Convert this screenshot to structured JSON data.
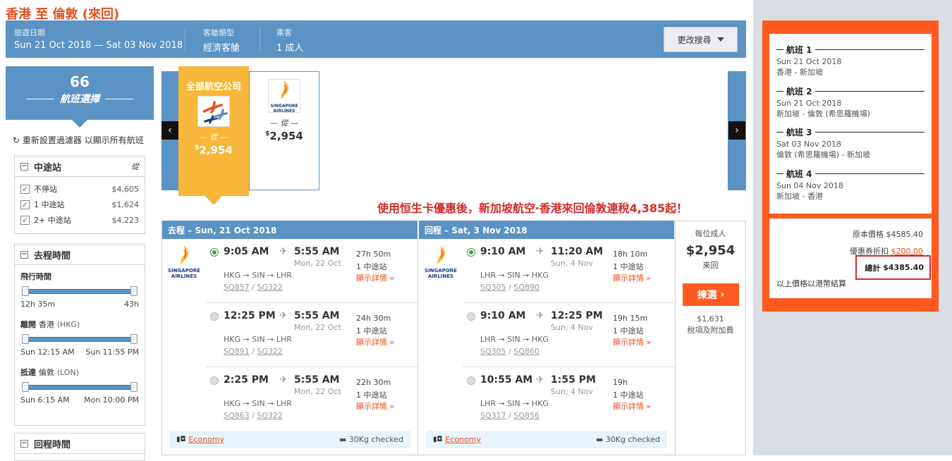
{
  "page_title": "香港 至 倫敦 (來回)",
  "search": {
    "date_label": "旅遊日期",
    "date_value": "Sun 21 Oct 2018 — Sat 03 Nov 2018",
    "cabin_label": "客艙類型",
    "cabin_value": "經濟客艙",
    "pax_label": "乘客",
    "pax_value": "1 成人",
    "change_button": "更改搜尋"
  },
  "sidebar": {
    "count": "66",
    "count_label": "航班選擇",
    "reset": "重新設置過濾器 以顯示所有航班",
    "stops": {
      "title": "中途站",
      "from": "從",
      "items": [
        {
          "label": "不停站",
          "price": "$4,605"
        },
        {
          "label": "1 中途站",
          "price": "$1,624"
        },
        {
          "label": "2+ 中途站",
          "price": "$4,223"
        }
      ]
    },
    "outbound": {
      "title": "去程時間",
      "duration_label": "飛行時間",
      "duration_min": "12h 35m",
      "duration_max": "43h",
      "depart_label": "離開",
      "depart_city": "香港",
      "depart_code": "(HKG)",
      "depart_min": "Sun 12:15 AM",
      "depart_max": "Sun 11:55 PM",
      "arrive_label": "抵達",
      "arrive_city": "倫敦",
      "arrive_code": "(LON)",
      "arrive_min": "Sun 6:15 AM",
      "arrive_max": "Mon 10:00 PM"
    },
    "return": {
      "title": "回程時間"
    }
  },
  "carousel": {
    "all_airlines_label": "全部航空公司",
    "all_from": "從",
    "all_price": "2,954",
    "sq_name": "SINGAPORE AIRLINES",
    "sq_from": "從",
    "sq_price": "2,954",
    "currency": "$",
    "prev": "‹",
    "next": "›"
  },
  "promo": "使用恒生卡優惠後，新加坡航空‧香港來回倫敦連稅4,385起！",
  "outbound": {
    "header": "去程 – Sun, 21 Oct 2018",
    "flights": [
      {
        "dep": "9:05 AM",
        "arr": "5:55 AM",
        "arr_date": "Mon, 22 Oct",
        "route": "HKG → SIN → LHR",
        "code1": "SQ857",
        "code2": "SQ322",
        "dur": "27h 50m",
        "stops": "1 中途站",
        "details": "顯示詳情 »",
        "selected": true
      },
      {
        "dep": "12:25 PM",
        "arr": "5:55 AM",
        "arr_date": "Mon, 22 Oct",
        "route": "HKG → SIN → LHR",
        "code1": "SQ891",
        "code2": "SQ322",
        "dur": "24h 30m",
        "stops": "1 中途站",
        "details": "顯示詳情 »",
        "selected": false
      },
      {
        "dep": "2:25 PM",
        "arr": "5:55 AM",
        "arr_date": "Mon, 22 Oct",
        "route": "HKG → SIN → LHR",
        "code1": "SQ863",
        "code2": "SQ322",
        "dur": "22h 30m",
        "stops": "1 中途站",
        "details": "顯示詳情 »",
        "selected": false
      }
    ],
    "cabin": "Economy",
    "baggage": "30Kg checked"
  },
  "inbound": {
    "header": "回程 – Sat, 3 Nov 2018",
    "flights": [
      {
        "dep": "9:10 AM",
        "arr": "11:20 AM",
        "arr_date": "Sun, 4 Nov",
        "route": "LHR → SIN → HKG",
        "code1": "SQ305",
        "code2": "SQ890",
        "dur": "18h 10m",
        "stops": "1 中途站",
        "details": "顯示詳情 »",
        "selected": true
      },
      {
        "dep": "9:10 AM",
        "arr": "12:25 PM",
        "arr_date": "Sun, 4 Nov",
        "route": "LHR → SIN → HKG",
        "code1": "SQ305",
        "code2": "SQ860",
        "dur": "19h 15m",
        "stops": "1 中途站",
        "details": "顯示詳情 »",
        "selected": false
      },
      {
        "dep": "10:55 AM",
        "arr": "1:55 PM",
        "arr_date": "Sun, 4 Nov",
        "route": "LHR → SIN → HKG",
        "code1": "SQ317",
        "code2": "SQ856",
        "dur": "19h",
        "stops": "1 中途站",
        "details": "顯示詳情 »",
        "selected": false
      }
    ],
    "cabin": "Economy",
    "baggage": "30Kg checked"
  },
  "price_box": {
    "per_adult": "每位成人",
    "price": "$2,954",
    "trip": "來回",
    "select": "揀選",
    "tax": "$1,631",
    "tax_label": "稅項及附加費"
  },
  "summary": {
    "legs": [
      {
        "title": "航班 1",
        "date": "Sun 21 Oct 2018",
        "route": "香港 - 新加坡"
      },
      {
        "title": "航班 2",
        "date": "Sun 21 Oct 2018",
        "route": "新加坡 - 倫敦 (希思羅機場)"
      },
      {
        "title": "航班 3",
        "date": "Sat 03 Nov 2018",
        "route": "倫敦 (希思羅機場) - 新加坡"
      },
      {
        "title": "航班 4",
        "date": "Sun 04 Nov 2018",
        "route": "新加坡 - 香港"
      }
    ],
    "original_label": "原本價格",
    "original_value": "$4585.40",
    "discount_label": "優惠券折扣",
    "discount_value": "$200.00",
    "total_label": "總計",
    "total_value": "$4385.40",
    "note": "以上價格以港幣結算"
  },
  "colors": {
    "accent": "#5b93c4",
    "orange": "#ff5a1f",
    "gold": "#f7b73b",
    "red": "#d42b2b"
  }
}
